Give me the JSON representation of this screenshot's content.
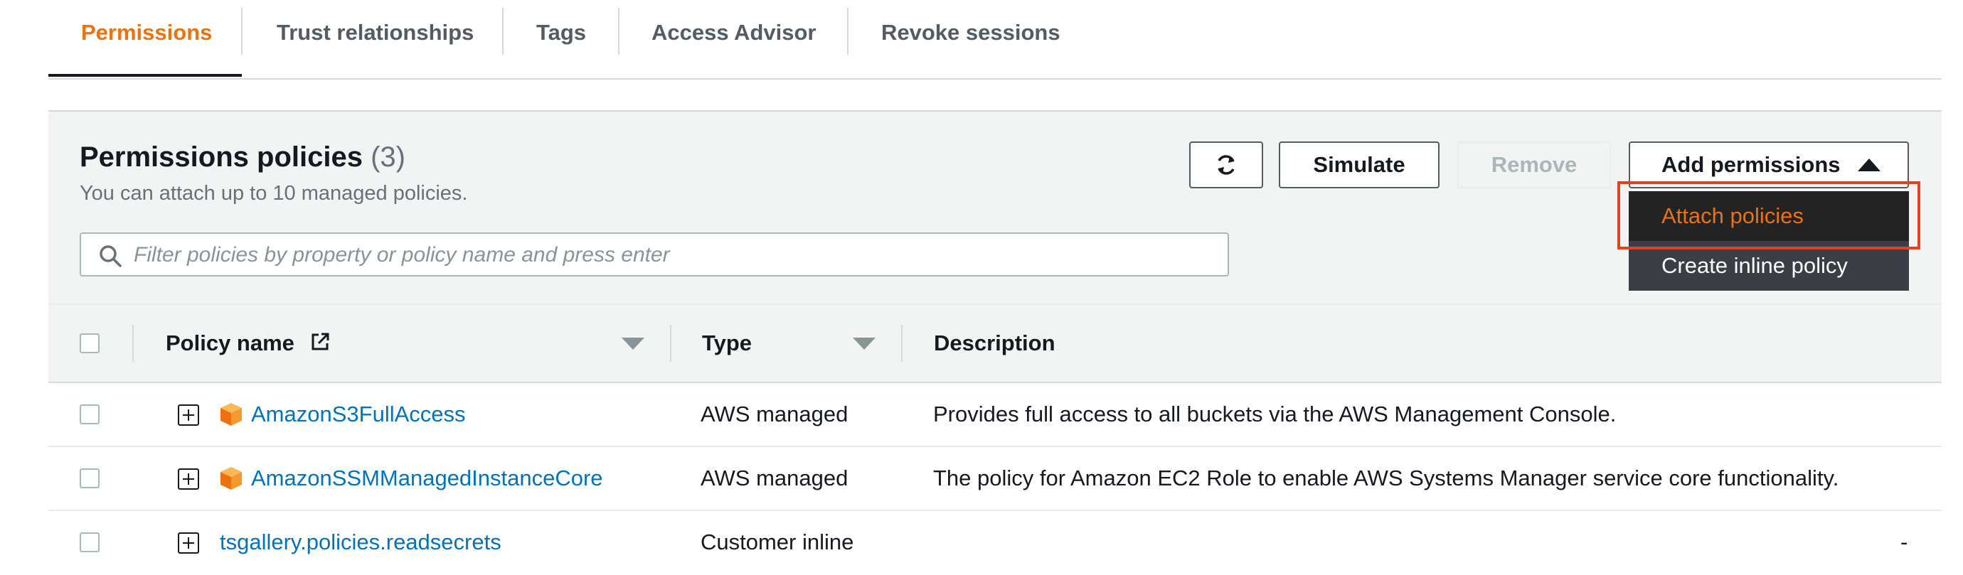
{
  "tabs": [
    {
      "label": "Permissions",
      "active": true
    },
    {
      "label": "Trust relationships",
      "active": false
    },
    {
      "label": "Tags",
      "active": false
    },
    {
      "label": "Access Advisor",
      "active": false
    },
    {
      "label": "Revoke sessions",
      "active": false
    }
  ],
  "panel": {
    "title": "Permissions policies",
    "count": "(3)",
    "subtitle": "You can attach up to 10 managed policies.",
    "search_placeholder": "Filter policies by property or policy name and press enter",
    "buttons": {
      "refresh_icon": "refresh-icon",
      "simulate": "Simulate",
      "remove": "Remove",
      "add_permissions": "Add permissions"
    },
    "dropdown": {
      "open": true,
      "items": [
        {
          "label": "Attach policies",
          "highlighted": true
        },
        {
          "label": "Create inline policy",
          "highlighted": false
        }
      ]
    }
  },
  "table": {
    "columns": {
      "policy_name": "Policy name",
      "type": "Type",
      "description": "Description"
    },
    "rows": [
      {
        "name": "AmazonS3FullAccess",
        "type": "AWS managed",
        "description": "Provides full access to all buckets via the AWS Management Console.",
        "icon": "aws-managed-policy-icon"
      },
      {
        "name": "AmazonSSMManagedInstanceCore",
        "type": "AWS managed",
        "description": "The policy for Amazon EC2 Role to enable AWS Systems Manager service core functionality.",
        "icon": "aws-managed-policy-icon"
      },
      {
        "name": "tsgallery.policies.readsecrets",
        "type": "Customer inline",
        "description": "-",
        "icon": ""
      }
    ]
  },
  "colors": {
    "accent": "#ec7211",
    "link": "#0073bb",
    "highlight_border": "#e3411f",
    "dropdown_bg": "#2a2e33",
    "header_bg": "#f2f3f3"
  }
}
